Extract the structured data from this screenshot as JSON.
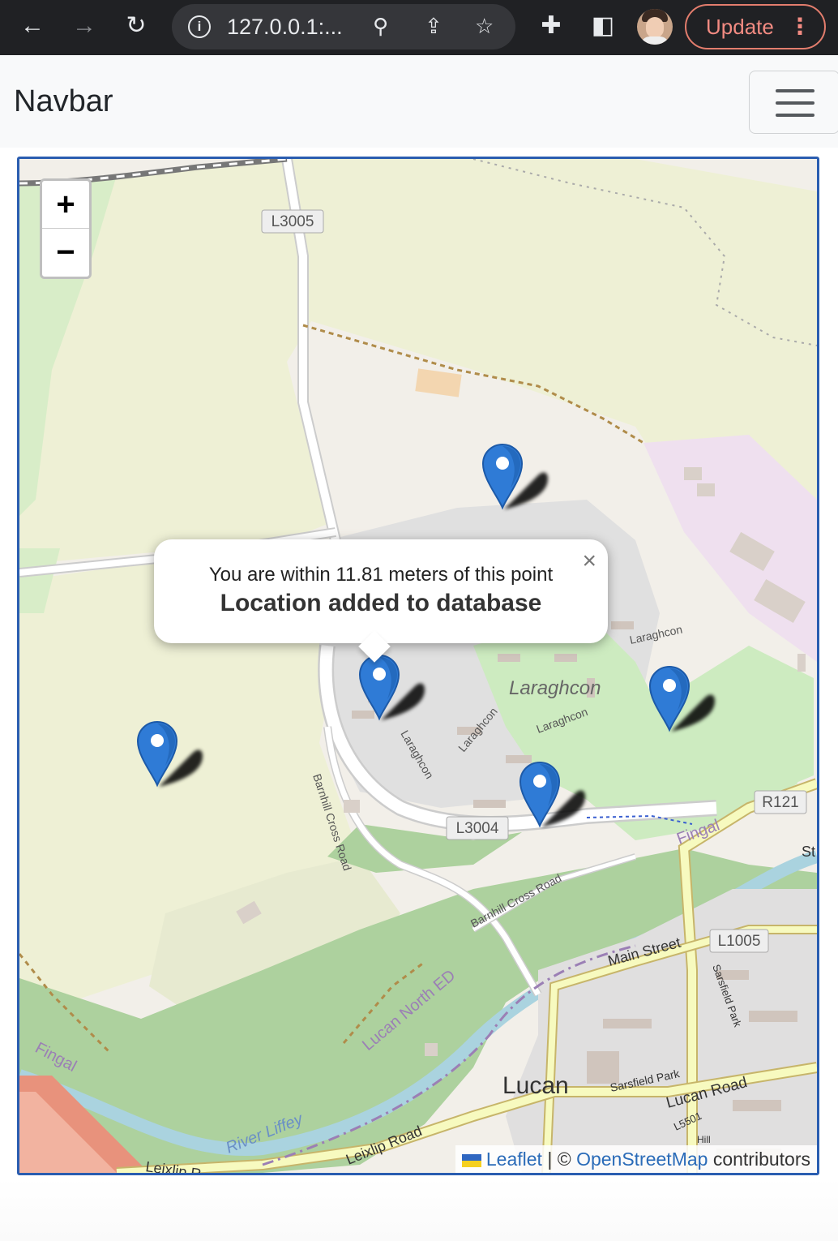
{
  "browser": {
    "url": "127.0.0.1:...",
    "update_label": "Update"
  },
  "navbar": {
    "brand": "Navbar"
  },
  "map": {
    "zoom_in": "+",
    "zoom_out": "−",
    "popup": {
      "line1": "You are within 11.81 meters of this point",
      "line2": "Location added to database",
      "close": "×"
    },
    "attribution": {
      "leaflet": "Leaflet",
      "sep": "|",
      "copy": "©",
      "osm": "OpenStreetMap",
      "rest": "contributors"
    },
    "labels": {
      "l3005": "L3005",
      "l3004": "L3004",
      "r121": "R121",
      "l1005": "L1005",
      "laraghcon_big": "Laraghcon",
      "laraghcon_a": "Laraghcon",
      "laraghcon_b": "Laraghcon",
      "laraghcon_c": "Laraghcon",
      "laraghcon_d": "Laraghcon",
      "barnhill1": "Barnhill Cross Road",
      "barnhill2": "Barnhill Cross Road",
      "fingal1": "Fingal",
      "fingal2": "Fingal",
      "lucan_ed": "Lucan North ED",
      "main_street": "Main Street",
      "sarsfield_park": "Sarsfield Park",
      "sarsfield_park2": "Sarsfield Park",
      "lucan": "Lucan",
      "lucan_road": "Lucan Road",
      "l5501": "L5501",
      "river_liffey": "River Liffey",
      "leixlip_road": "Leixlip Road",
      "leixlip_frag": "Leixlip R",
      "st_frag": "St",
      "hill_frag": "Hill"
    },
    "marker_count": 5
  }
}
